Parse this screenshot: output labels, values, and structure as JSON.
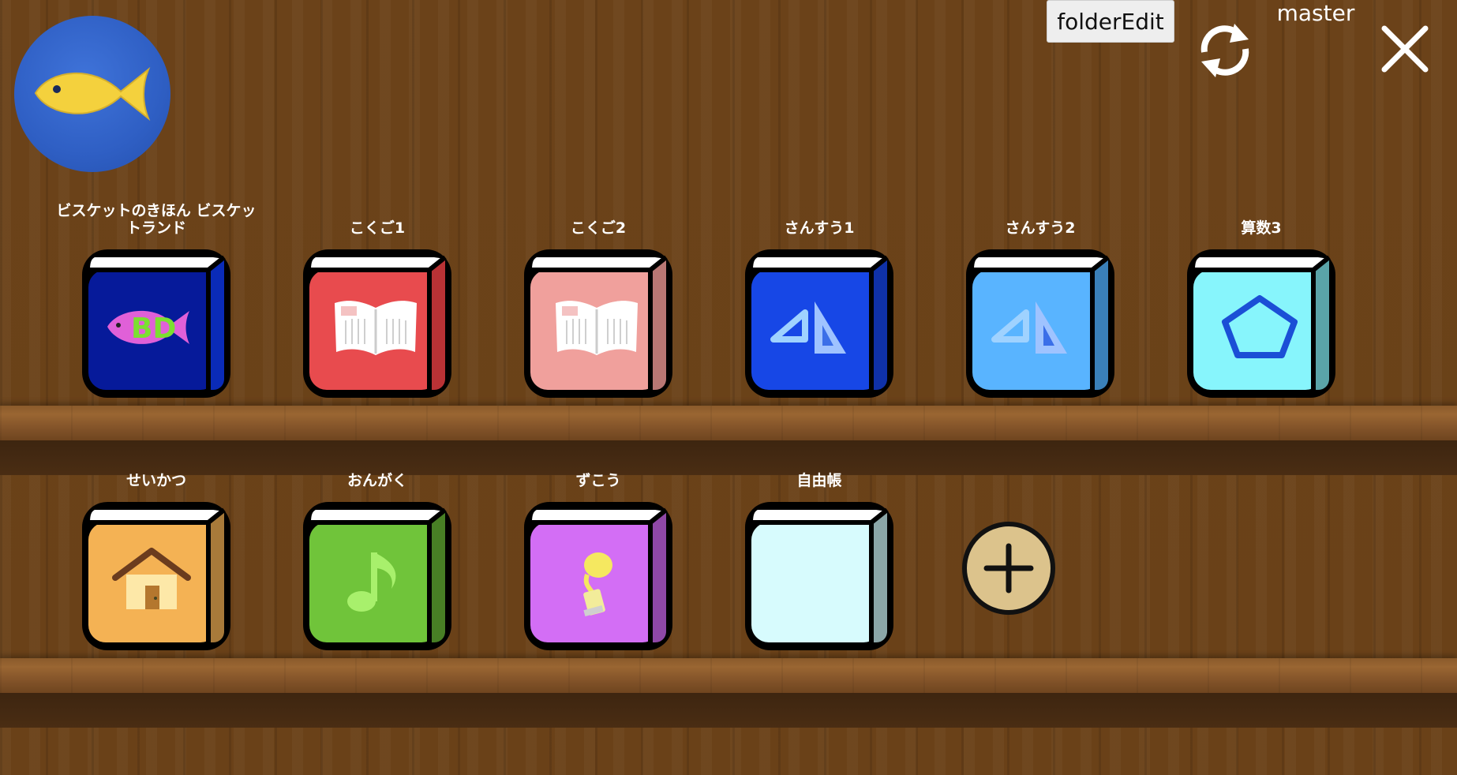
{
  "header": {
    "folder_edit_label": "folderEdit",
    "user_label": "master"
  },
  "colors": {
    "wood": "#6b4219",
    "avatar_bg": "#2f5fc4",
    "fish": "#f4d13d"
  },
  "books": [
    {
      "label": "ビスケットのきほん ビスケットランド",
      "cover": "#061a9a",
      "spine": "#0a2bb8",
      "icon": "fish-icon"
    },
    {
      "label": "こくご1",
      "cover": "#e84b4e",
      "spine": "#b93235",
      "icon": "open-book-icon"
    },
    {
      "label": "こくご2",
      "cover": "#f0a09c",
      "spine": "#b97774",
      "icon": "open-book-icon"
    },
    {
      "label": "さんすう1",
      "cover": "#1747e6",
      "spine": "#0f31a8",
      "icon": "triangle-ruler-icon"
    },
    {
      "label": "さんすう2",
      "cover": "#59b4ff",
      "spine": "#3a80b9",
      "icon": "triangle-ruler-icon"
    },
    {
      "label": "算数3",
      "cover": "#87f5fc",
      "spine": "#5aa4a8",
      "icon": "pentagon-icon"
    },
    {
      "label": "せいかつ",
      "cover": "#f4b254",
      "spine": "#a87a3a",
      "icon": "house-icon"
    },
    {
      "label": "おんがく",
      "cover": "#70c43a",
      "spine": "#487f25",
      "icon": "music-note-icon"
    },
    {
      "label": "ずこう",
      "cover": "#d36ef5",
      "spine": "#8f48a7",
      "icon": "paint-tube-icon"
    },
    {
      "label": "自由帳",
      "cover": "#d7fbfd",
      "spine": "#8ba6a8",
      "icon": "blank-icon"
    }
  ]
}
